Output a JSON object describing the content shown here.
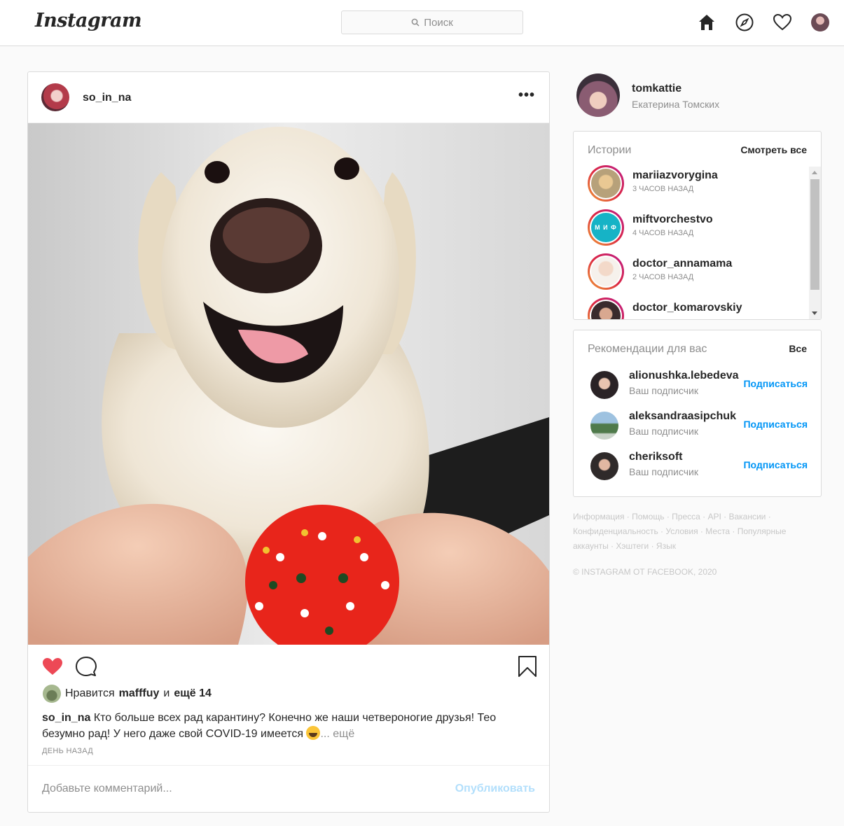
{
  "header": {
    "logo": "Instagram",
    "search_placeholder": "Поиск",
    "icons": [
      "home-icon",
      "explore-icon",
      "activity-heart-icon",
      "profile-avatar"
    ]
  },
  "post": {
    "username": "so_in_na",
    "more": "•••",
    "likes_prefix": "Нравится",
    "likes_user": "mafffuy",
    "likes_and": "и",
    "likes_more": "ещё 14",
    "caption_user": "so_in_na",
    "caption_text": "Кто больше всех рад карантину? Конечно же наши четвероногие друзья! Тео безумно рад! У него даже свой COVID-19 имеется",
    "caption_more": "... ещё",
    "date": "ДЕНЬ НАЗАД",
    "comment_placeholder": "Добавьте комментарий...",
    "publish": "Опубликовать",
    "liked": true,
    "like_color": "#ed4956"
  },
  "me": {
    "username": "tomkattie",
    "fullname": "Екатерина Томских"
  },
  "stories": {
    "title": "Истории",
    "view_all": "Смотреть все",
    "items": [
      {
        "user": "mariiazvorygina",
        "time": "3 ЧАСОВ НАЗАД"
      },
      {
        "user": "miftvorchestvo",
        "time": "4 ЧАСОВ НАЗАД",
        "logo_text": "М И Ф"
      },
      {
        "user": "doctor_annamama",
        "time": "2 ЧАСОВ НАЗАД"
      },
      {
        "user": "doctor_komarovskiy",
        "time": ""
      }
    ]
  },
  "recommendations": {
    "title": "Рекомендации для вас",
    "all": "Все",
    "items": [
      {
        "user": "alionushka.lebedeva",
        "sub": "Ваш подписчик",
        "action": "Подписаться"
      },
      {
        "user": "aleksandraasipchuk",
        "sub": "Ваш подписчик",
        "action": "Подписаться"
      },
      {
        "user": "cheriksoft",
        "sub": "Ваш подписчик",
        "action": "Подписаться"
      }
    ]
  },
  "footer": {
    "links": "Информация · Помощь · Пресса · API · Вакансии · Конфиденциальность · Условия · Места · Популярные аккаунты · Хэштеги · Язык",
    "copyright": "© INSTAGRAM ОТ FACEBOOK, 2020"
  },
  "colors": {
    "link_blue": "#0095f6",
    "publish_disabled": "#b2dffc",
    "border": "#dbdbdb"
  }
}
